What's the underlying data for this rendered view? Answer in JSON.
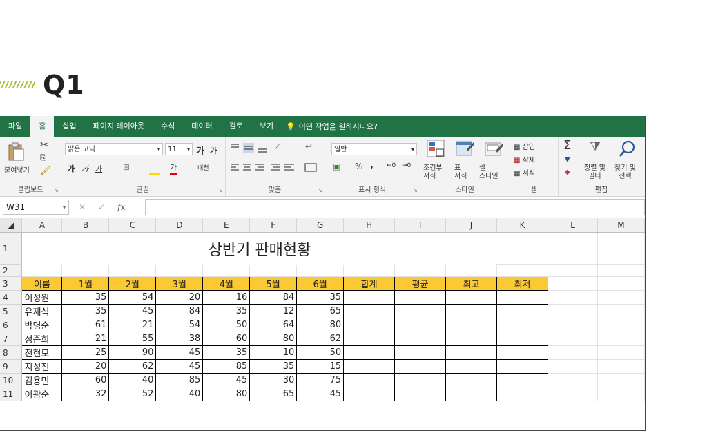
{
  "heading": {
    "label": "Q1"
  },
  "ribbon_tabs": [
    "파일",
    "홈",
    "삽입",
    "페이지 레이아웃",
    "수식",
    "데이터",
    "검토",
    "보기"
  ],
  "active_tab": "홈",
  "tell_me": "어떤 작업을 원하시나요?",
  "ribbon": {
    "clipboard": {
      "paste": "붙여넣기",
      "label": "클립보드"
    },
    "font": {
      "name": "맑은 고딕",
      "size": "11",
      "grow": "가",
      "shrink": "가",
      "bold": "가",
      "italic": "가",
      "underline": "가",
      "font_color": "가",
      "phonetic": "내천",
      "label": "글꼴"
    },
    "alignment": {
      "label": "맞춤"
    },
    "number": {
      "format": "일반",
      "percent": "%",
      "comma": ",",
      "label": "표시 형식"
    },
    "styles": {
      "conditional": "조건부\n서식",
      "table": "표\n서식",
      "cell": "셀\n스타일",
      "label": "스타일"
    },
    "cells": {
      "insert": "삽입",
      "delete": "삭제",
      "format": "서식",
      "label": "셀"
    },
    "editing": {
      "sum": "Σ",
      "sort": "정렬 및\n필터",
      "find": "찾기 및\n선택",
      "label": "편집"
    }
  },
  "formula_bar": {
    "name_box": "W31",
    "fx": "fx",
    "value": ""
  },
  "columns": [
    "A",
    "B",
    "C",
    "D",
    "E",
    "F",
    "G",
    "H",
    "I",
    "J",
    "K",
    "L",
    "M"
  ],
  "sheet": {
    "title": "상반기 판매현황",
    "headers": [
      "이름",
      "1월",
      "2월",
      "3월",
      "4월",
      "5월",
      "6월",
      "합계",
      "평균",
      "최고",
      "최저"
    ],
    "rows": [
      {
        "name": "이성원",
        "v": [
          35,
          54,
          20,
          16,
          84,
          35
        ]
      },
      {
        "name": "유재식",
        "v": [
          35,
          45,
          84,
          35,
          12,
          65
        ]
      },
      {
        "name": "박명순",
        "v": [
          61,
          21,
          54,
          50,
          64,
          80
        ]
      },
      {
        "name": "정준희",
        "v": [
          21,
          55,
          38,
          60,
          80,
          62
        ]
      },
      {
        "name": "전현모",
        "v": [
          25,
          90,
          45,
          35,
          10,
          50
        ]
      },
      {
        "name": "지성진",
        "v": [
          20,
          62,
          45,
          85,
          35,
          15
        ]
      },
      {
        "name": "김용민",
        "v": [
          60,
          40,
          85,
          45,
          30,
          75
        ]
      },
      {
        "name": "이광순",
        "v": [
          32,
          52,
          40,
          80,
          65,
          45
        ]
      }
    ]
  },
  "colors": {
    "excel_green": "#217346",
    "header_fill": "#fcc934",
    "heading_accent": "#a4c639"
  }
}
